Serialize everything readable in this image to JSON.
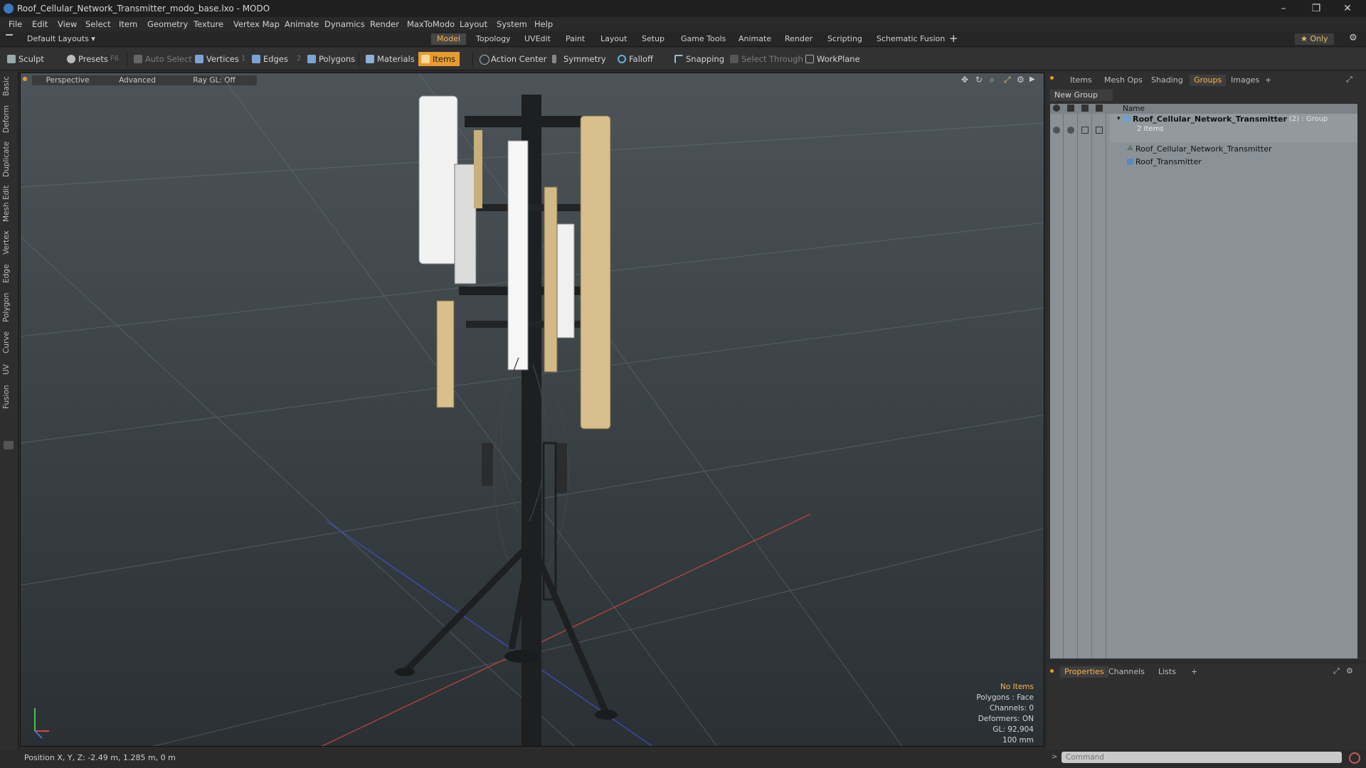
{
  "window": {
    "title": "Roof_Cellular_Network_Transmitter_modo_base.lxo - MODO",
    "controls": [
      "–",
      "❐",
      "✕"
    ]
  },
  "menubar": {
    "items": [
      "File",
      "Edit",
      "View",
      "Select",
      "Item",
      "Geometry",
      "Texture",
      "Vertex Map",
      "Animate",
      "Dynamics",
      "Render",
      "MaxToModo",
      "Layout",
      "System",
      "Help"
    ]
  },
  "layoutbar": {
    "preset": "Default Layouts ▾",
    "tabs": [
      "Model",
      "Topology",
      "UVEdit",
      "Paint",
      "Layout",
      "Setup",
      "Game Tools",
      "Animate",
      "Render",
      "Scripting",
      "Schematic Fusion"
    ],
    "active_tab": "Model",
    "only_label": "★ Only"
  },
  "toolbar": {
    "sculpt": "Sculpt",
    "presets": "Presets",
    "presets_key": "F6",
    "auto_select": "Auto Select",
    "vertices": "Vertices",
    "vertices_key": "1",
    "edges": "Edges",
    "edges_key": "2",
    "polygons": "Polygons",
    "materials": "Materials",
    "items": "Items",
    "action_center": "Action Center",
    "symmetry": "Symmetry",
    "falloff": "Falloff",
    "snapping": "Snapping",
    "select_through": "Select Through",
    "workplane": "WorkPlane"
  },
  "left_tabs": [
    "Basic",
    "Deform",
    "Duplicate",
    "Mesh Edit",
    "Vertex",
    "Edge",
    "Polygon",
    "Curve",
    "UV",
    "Fusion"
  ],
  "viewport": {
    "perspective": "Perspective",
    "advanced": "Advanced",
    "raygl": "Ray GL: Off",
    "info": {
      "no_items": "No Items",
      "polygons": "Polygons : Face",
      "channels": "Channels: 0",
      "deformers": "Deformers: ON",
      "gl": "GL: 92,904",
      "scale": "100 mm"
    }
  },
  "status": {
    "position": "Position X, Y, Z:  -2.49 m, 1.285 m, 0 m"
  },
  "right_panel": {
    "tabs": [
      "Items",
      "Mesh Ops",
      "Shading",
      "Groups",
      "Images",
      "+"
    ],
    "active_tab": "Groups",
    "new_group": "New Group",
    "name_header": "Name",
    "group_name": "Roof_Cellular_Network_Transmitter",
    "group_suffix": "(2) : Group",
    "items_count": "2 Items",
    "children": [
      "Roof_Cellular_Network_Transmitter",
      "Roof_Transmitter"
    ]
  },
  "props_panel": {
    "tabs": [
      "Properties",
      "Channels",
      "Lists",
      "+"
    ],
    "active_tab": "Properties"
  },
  "command": {
    "placeholder": "Command"
  },
  "colors": {
    "accent": "#e79b2d",
    "active_text": "#ffb24a",
    "panel_bg": "#2f2f2f",
    "list_bg": "#8a9298"
  }
}
